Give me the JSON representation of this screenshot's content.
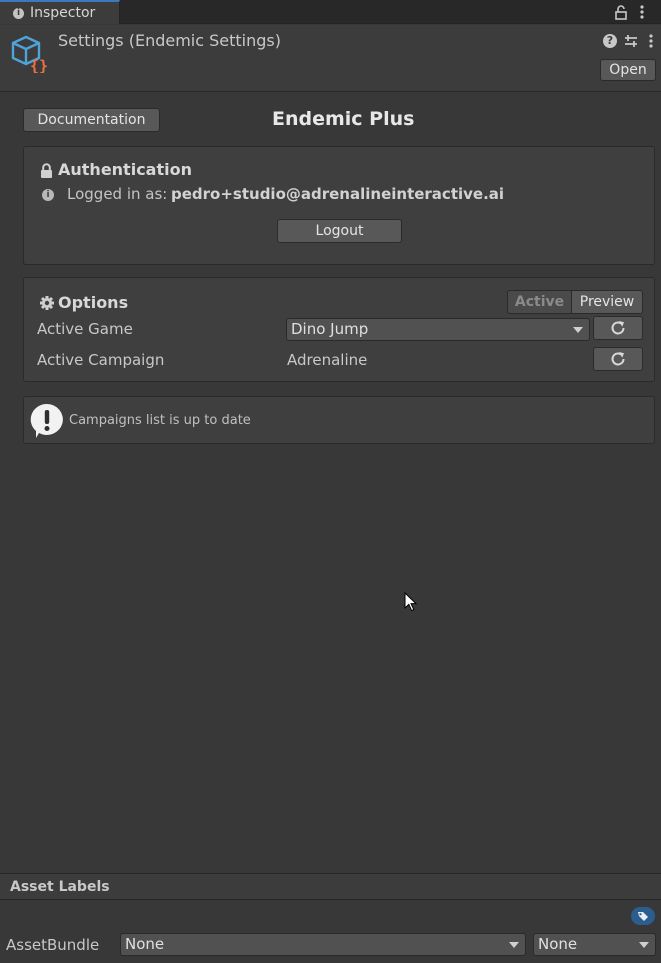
{
  "tab": {
    "label": "Inspector"
  },
  "header": {
    "title": "Settings (Endemic Settings)",
    "open_label": "Open",
    "help_glyph": "?"
  },
  "documentation_label": "Documentation",
  "main_title": "Endemic Plus",
  "auth": {
    "title": "Authentication",
    "logged_label": "Logged in as:",
    "logged_value": "pedro+studio@adrenalineinteractive.ai",
    "logout_label": "Logout"
  },
  "options": {
    "title": "Options",
    "seg_active": "Active",
    "seg_preview": "Preview",
    "game_label": "Active Game",
    "game_value": "Dino Jump",
    "campaign_label": "Active Campaign",
    "campaign_value": "Adrenaline"
  },
  "help_message": "Campaigns list is up to date",
  "asset_labels": {
    "title": "Asset Labels",
    "bundle_label": "AssetBundle",
    "bundle_value": "None",
    "variant_value": "None"
  },
  "colors": {
    "tab_accent": "#3a79bb",
    "icon_blue": "#4ea3d8",
    "icon_orange": "#f07040"
  },
  "icons": [
    "info-icon",
    "lock-icon",
    "kebab-menu-icon",
    "settings-asset-icon",
    "help-icon",
    "preset-icon",
    "padlock-icon",
    "gear-icon",
    "refresh-icon",
    "warning-icon",
    "tag-icon",
    "chevron-down-icon",
    "mouse-cursor-icon"
  ]
}
